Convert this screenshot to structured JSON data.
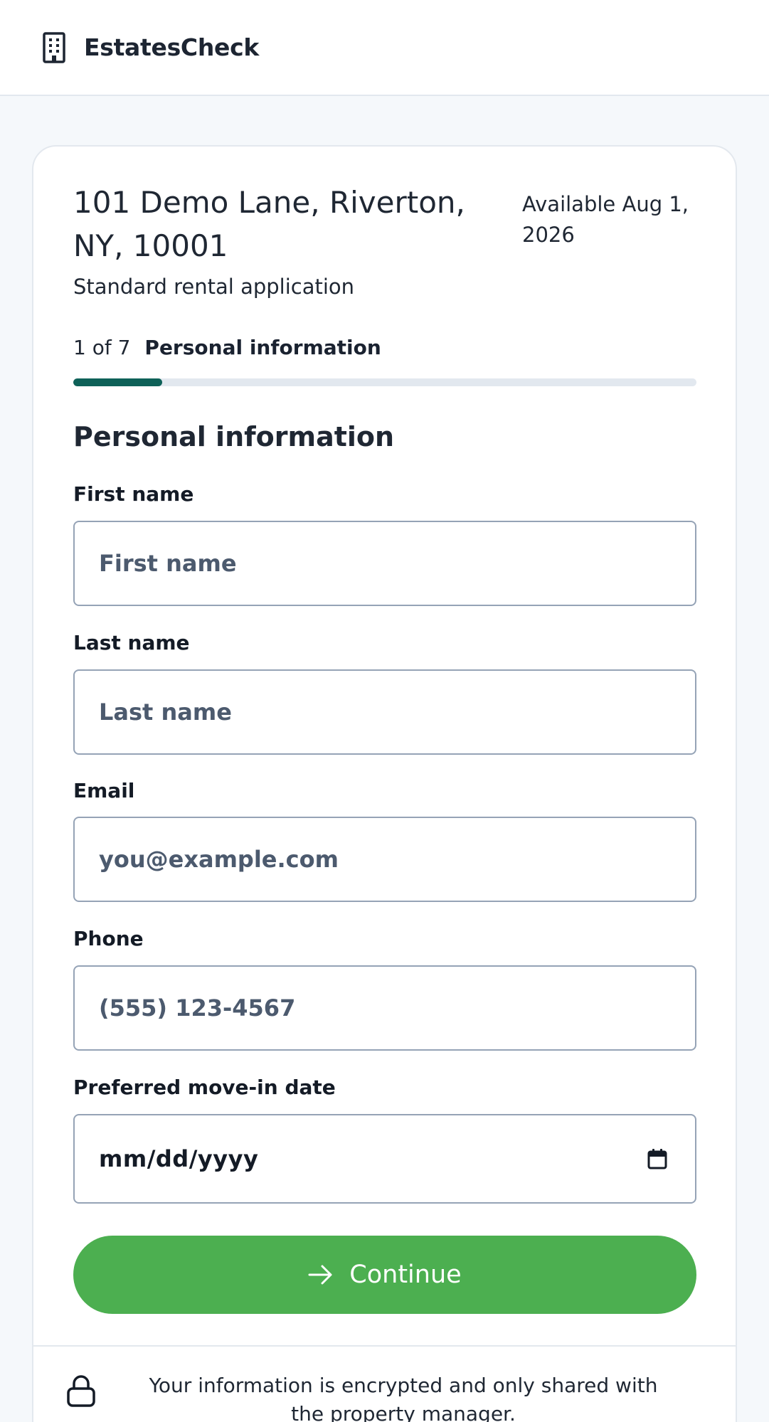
{
  "header": {
    "brand_name": "EstatesCheck",
    "brand_icon": "building-icon"
  },
  "property": {
    "address": "101 Demo Lane, Riverton, NY, 10001",
    "availability": "Available Aug 1, 2026",
    "application_type": "Standard rental application"
  },
  "progress": {
    "step_count": "1 of 7",
    "step_name": "Personal information",
    "fraction": 0.143,
    "color": "#0e6158"
  },
  "form": {
    "section_title": "Personal information",
    "fields": {
      "first_name": {
        "label": "First name",
        "placeholder": "First name",
        "value": ""
      },
      "last_name": {
        "label": "Last name",
        "placeholder": "Last name",
        "value": ""
      },
      "email": {
        "label": "Email",
        "placeholder": "you@example.com",
        "value": ""
      },
      "phone": {
        "label": "Phone",
        "placeholder": "(555) 123-4567",
        "value": ""
      },
      "move_in_date": {
        "label": "Preferred move-in date",
        "display": "mm/dd/yyyy",
        "icon": "calendar-icon"
      }
    },
    "continue_label": "Continue",
    "continue_icon": "arrow-right-icon",
    "continue_color": "#4caf50"
  },
  "footer": {
    "security_note": "Your information is encrypted and only shared with the property manager.",
    "icon": "lock-icon"
  }
}
